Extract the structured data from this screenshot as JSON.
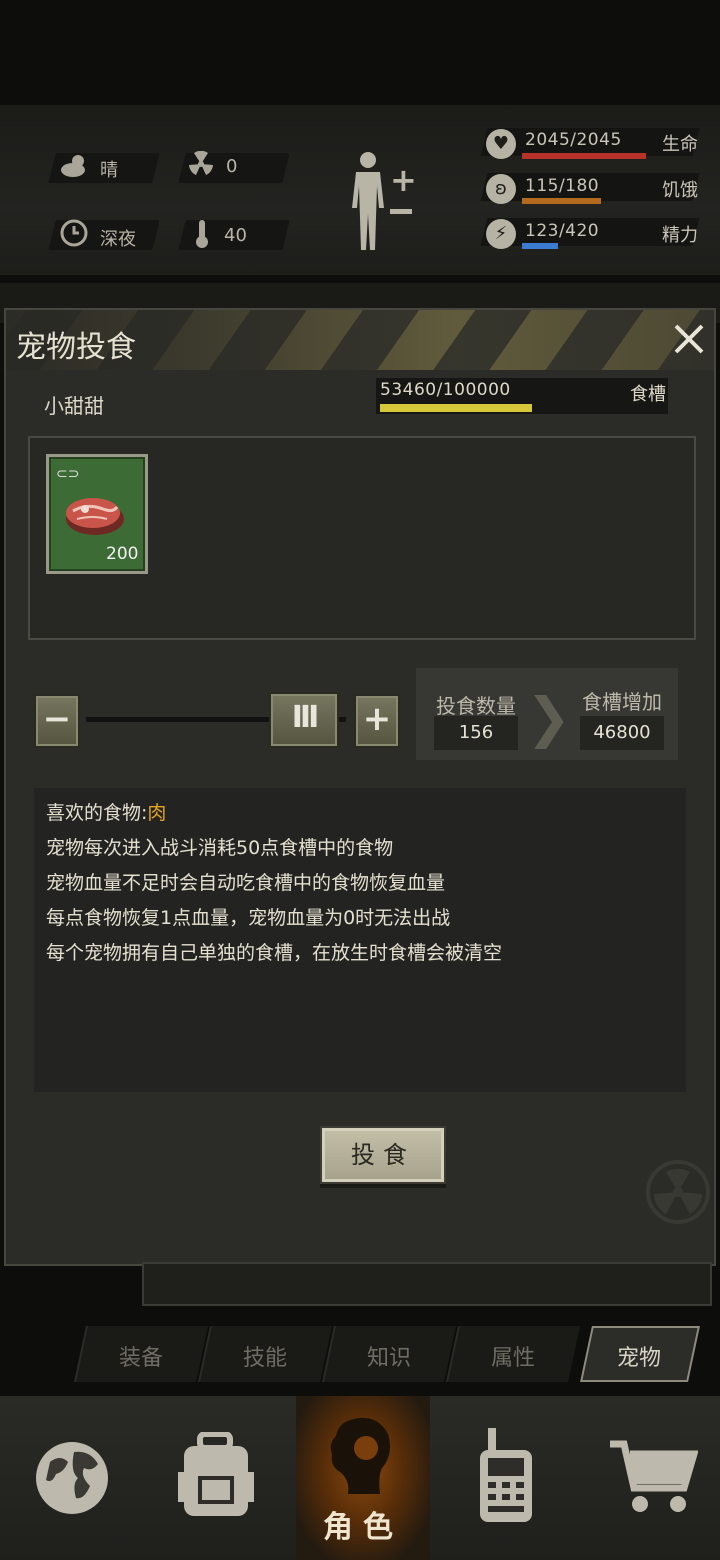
{
  "status": {
    "weather": "晴",
    "radiation": "0",
    "time_of_day": "深夜",
    "temperature": "40",
    "life": {
      "value": "2045/2045",
      "label": "生命",
      "fraction": 1.0,
      "color": "#b8322a"
    },
    "hunger": {
      "value": "115/180",
      "label": "饥饿",
      "fraction": 0.64,
      "color": "#b46a1e"
    },
    "energy": {
      "value": "123/420",
      "label": "精力",
      "fraction": 0.29,
      "color": "#3b7bd0"
    },
    "icons": [
      "cloud-sun-icon",
      "radiation-icon",
      "clock-icon",
      "thermometer-icon",
      "body-icon",
      "heart-icon",
      "stomach-icon",
      "energy-icon"
    ]
  },
  "dialog": {
    "title": "宠物投食",
    "pet_name": "小甜甜",
    "trough": {
      "value": "53460/100000",
      "label": "食槽",
      "fraction": 0.5346,
      "color": "#d6c63a"
    },
    "item": {
      "count": "200",
      "icon": "meat-icon",
      "bg_color": "#3c6b35"
    },
    "feed_qty_label": "投食数量",
    "feed_qty_value": "156",
    "trough_increase_label": "食槽增加",
    "trough_increase_value": "46800",
    "slider_fraction": 0.78,
    "desc": {
      "fav_label": "喜欢的食物:",
      "fav_value": "肉",
      "lines": [
        "宠物每次进入战斗消耗50点食槽中的食物",
        "宠物血量不足时会自动吃食槽中的食物恢复血量",
        "每点食物恢复1点血量，宠物血量为0时无法出战",
        "每个宠物拥有自己单独的食槽，在放生时食槽会被清空"
      ]
    },
    "feed_button": "投食"
  },
  "sub_tabs": [
    "装备",
    "技能",
    "知识",
    "属性",
    "宠物"
  ],
  "sub_tab_active": 4,
  "bottom_nav": {
    "items": [
      "globe-icon",
      "backpack-icon",
      "character-icon",
      "radio-icon",
      "cart-icon"
    ],
    "active_label": "角色"
  }
}
